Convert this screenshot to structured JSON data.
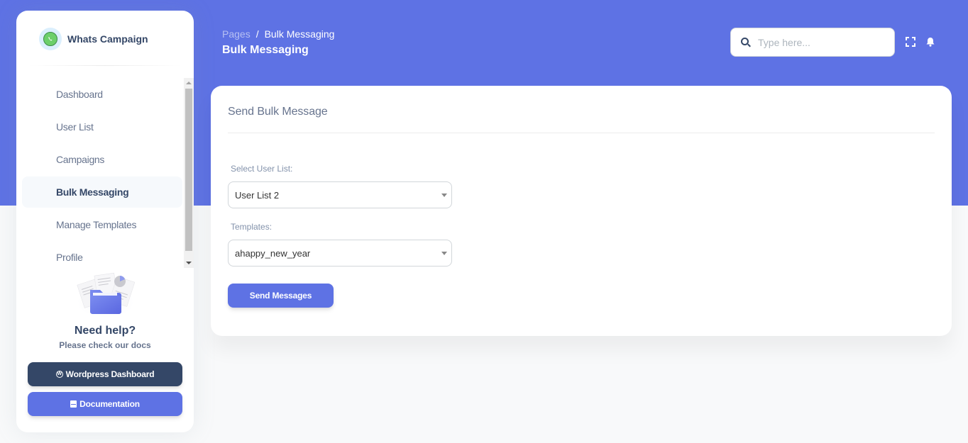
{
  "brand": {
    "name": "Whats Campaign",
    "logo_icon": "whatsapp-icon"
  },
  "sidebar": {
    "items": [
      {
        "label": "Dashboard",
        "active": false
      },
      {
        "label": "User List",
        "active": false
      },
      {
        "label": "Campaigns",
        "active": false
      },
      {
        "label": "Bulk Messaging",
        "active": true
      },
      {
        "label": "Manage Templates",
        "active": false
      },
      {
        "label": "Profile",
        "active": false
      }
    ],
    "help": {
      "illustration_icon": "folder-documents-icon",
      "title": "Need help?",
      "subtitle": "Please check our docs"
    },
    "buttons": {
      "wordpress": {
        "label": "Wordpress Dashboard",
        "icon": "wordpress-icon"
      },
      "documentation": {
        "label": "Documentation",
        "icon": "book-icon"
      }
    }
  },
  "header": {
    "breadcrumb": {
      "parent": "Pages",
      "separator": "/",
      "current": "Bulk Messaging"
    },
    "title": "Bulk Messaging",
    "search": {
      "placeholder": "Type here...",
      "value": "",
      "icon": "search-icon"
    },
    "icons": [
      "fullscreen-icon",
      "bell-icon"
    ]
  },
  "card": {
    "title": "Send Bulk Message",
    "user_list": {
      "label": "Select User List:",
      "selected": "User List 2"
    },
    "templates": {
      "label": "Templates:",
      "selected": "ahappy_new_year"
    },
    "submit_label": "Send Messages"
  },
  "colors": {
    "primary": "#5e72e4",
    "dark": "#344767",
    "muted": "#67748e",
    "background": "#f8f9fa"
  }
}
